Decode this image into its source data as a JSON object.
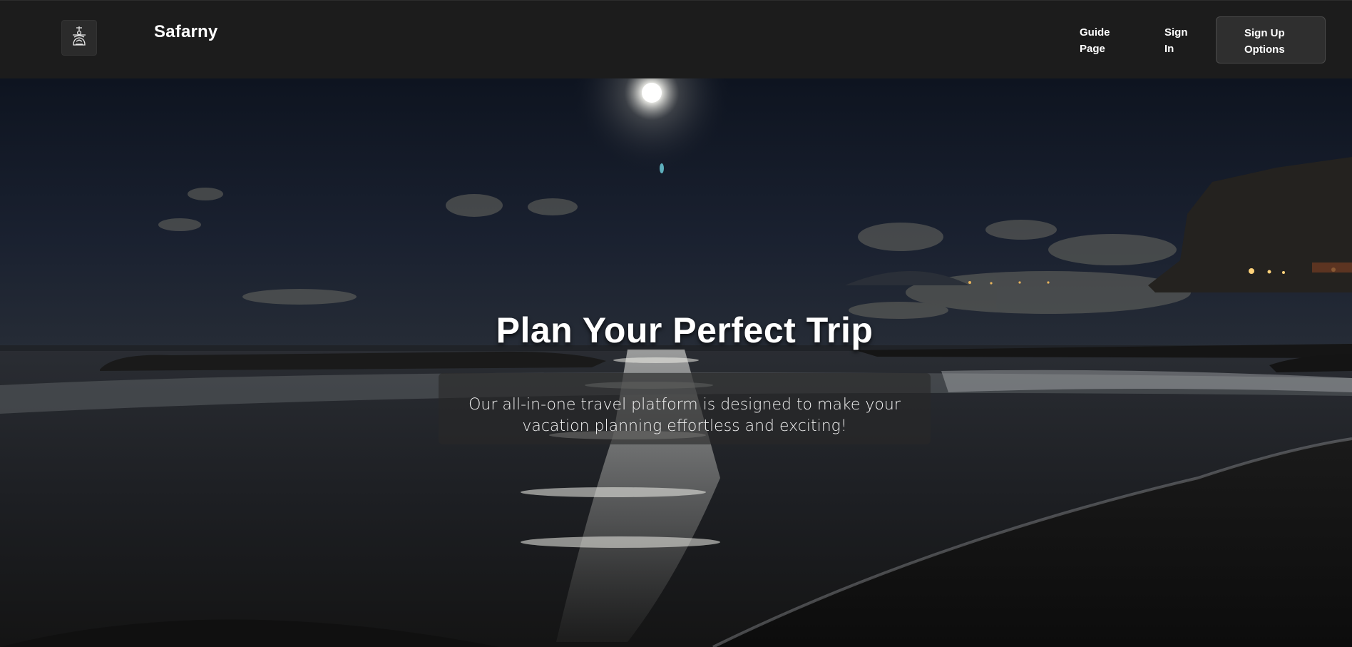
{
  "header": {
    "logo_icon": "compass-rose-icon",
    "brand": "Safarny",
    "nav": {
      "guide_label_line1": "Guide",
      "guide_label_line2": "Page",
      "signin_label_line1": "Sign",
      "signin_label_line2": "In",
      "signup_label_line1": "Sign Up",
      "signup_label_line2": "Options"
    }
  },
  "hero": {
    "title": "Plan Your Perfect Trip",
    "subtitle_line1": "Our all-in-one travel platform is designed to make your",
    "subtitle_line2": "vacation planning effortless and exciting!",
    "background": "night-beach-moonlight-image"
  },
  "colors": {
    "header_bg": "#1c1c1c",
    "button_bg": "#2f2f2f",
    "text": "#ffffff"
  }
}
